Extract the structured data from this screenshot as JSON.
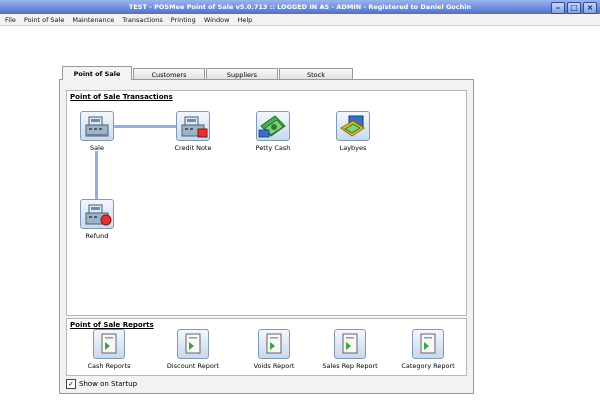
{
  "window": {
    "title": "TEST - POSMee Point of Sale v5.0.713 :: LOGGED IN AS - ADMIN - Registered to Daniel Gochin",
    "minimize": "–",
    "maximize": "□",
    "close": "×"
  },
  "menu": [
    "File",
    "Point of Sale",
    "Maintenance",
    "Transactions",
    "Printing",
    "Window",
    "Help"
  ],
  "tabs": [
    {
      "label": "Point of Sale",
      "active": true
    },
    {
      "label": "Customers",
      "active": false
    },
    {
      "label": "Suppliers",
      "active": false
    },
    {
      "label": "Stock",
      "active": false
    }
  ],
  "transactions": {
    "title": "Point of Sale Transactions",
    "items": [
      {
        "label": "Sale",
        "icon": "cash-register-icon"
      },
      {
        "label": "Credit Note",
        "icon": "cash-register-credit-icon"
      },
      {
        "label": "Petty Cash",
        "icon": "petty-cash-icon"
      },
      {
        "label": "Laybyes",
        "icon": "laybye-icon"
      },
      {
        "label": "Refund",
        "icon": "cash-register-refund-icon"
      }
    ]
  },
  "reports": {
    "title": "Point of Sale Reports",
    "items": [
      {
        "label": "Cash Reports",
        "icon": "report-icon"
      },
      {
        "label": "Discount Report",
        "icon": "report-icon"
      },
      {
        "label": "Voids Report",
        "icon": "report-icon"
      },
      {
        "label": "Sales Rep Report",
        "icon": "report-icon"
      },
      {
        "label": "Category Report",
        "icon": "report-icon"
      }
    ]
  },
  "startup": {
    "label": "Show on Startup",
    "checked": true,
    "check_mark": "✓"
  },
  "colors": {
    "titlebar": "#6f8fdc",
    "connector": "#93b0db",
    "panel": "#f2f2f2"
  }
}
